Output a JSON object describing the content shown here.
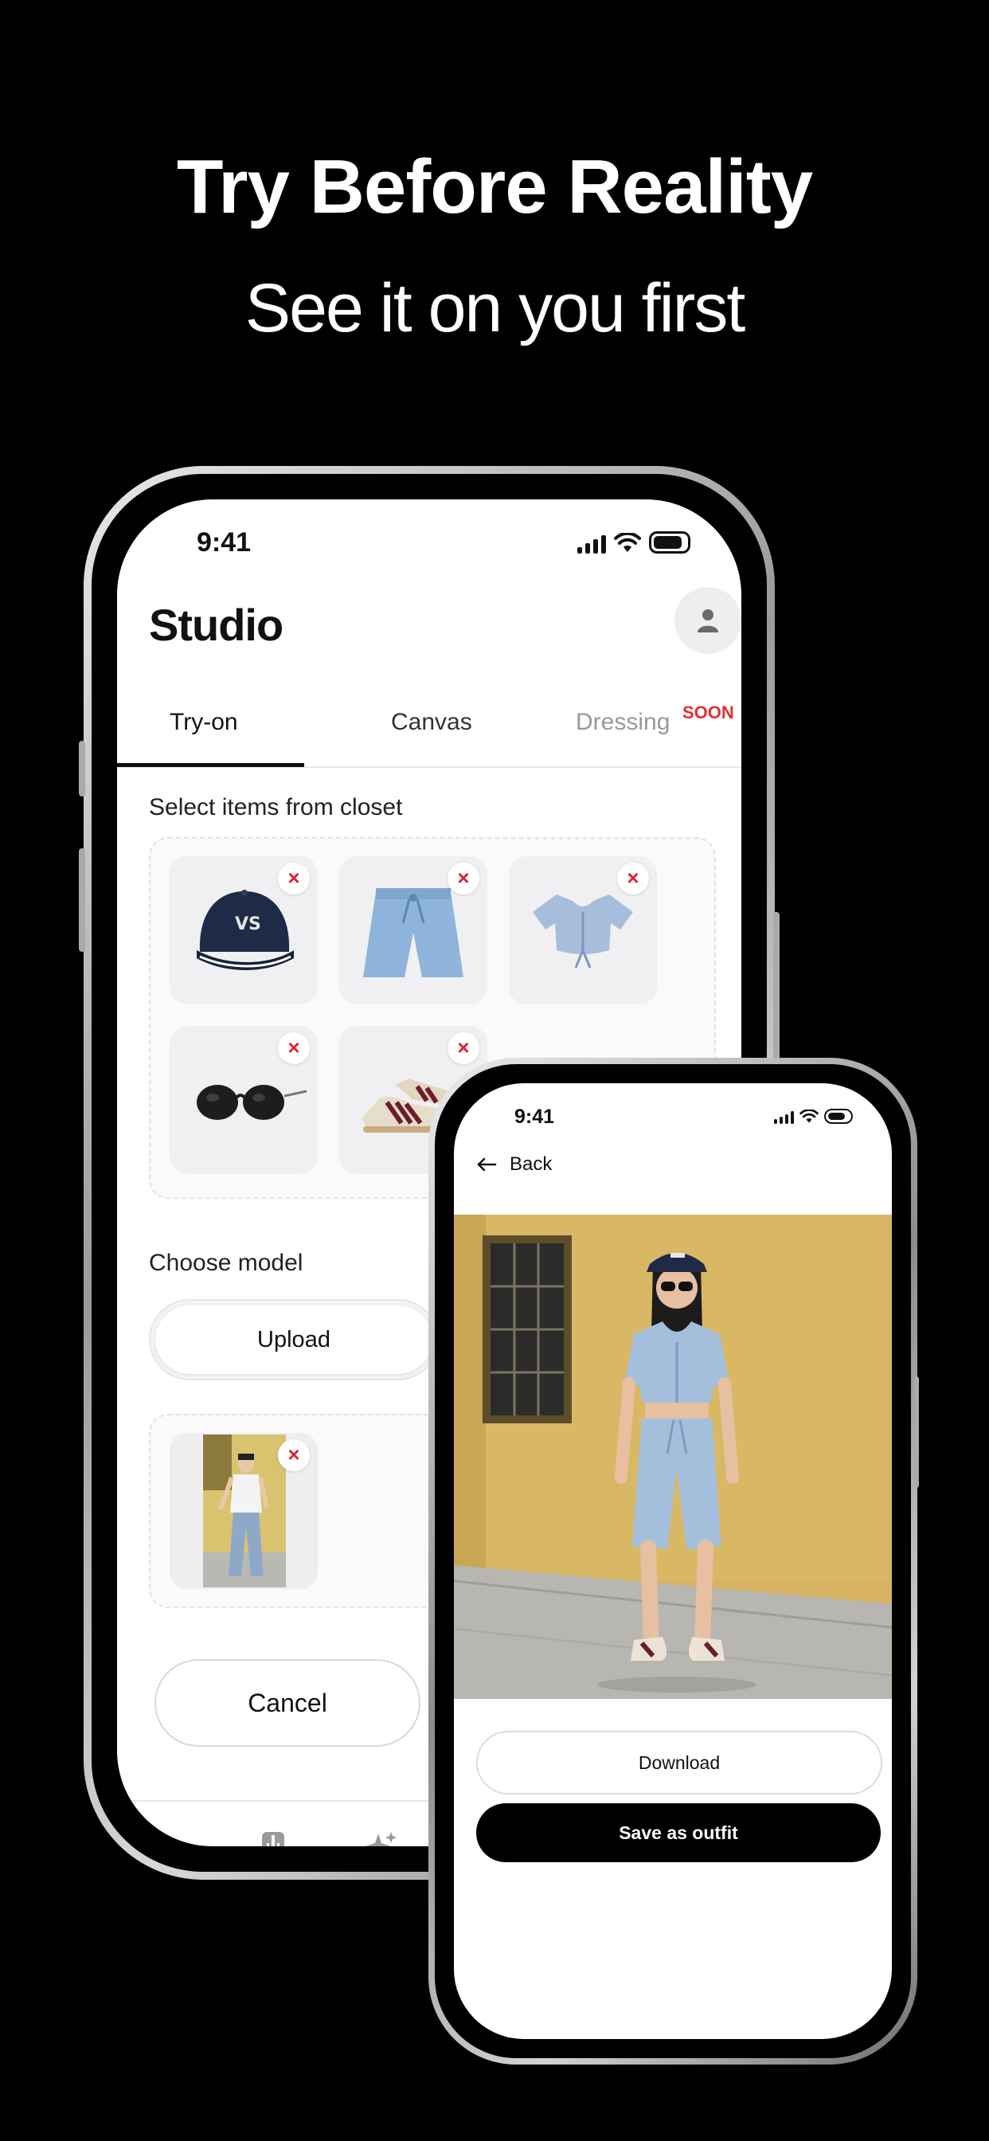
{
  "hero": {
    "title": "Try Before Reality",
    "subtitle": "See it on you first"
  },
  "phone_studio": {
    "status": {
      "time": "9:41"
    },
    "header": {
      "title": "Studio"
    },
    "tabs": [
      {
        "label": "Try-on",
        "active": true
      },
      {
        "label": "Canvas",
        "active": false
      },
      {
        "label": "Dressing",
        "active": false,
        "badge": "SOON"
      }
    ],
    "closet": {
      "label": "Select items from closet",
      "items": [
        {
          "icon": "cap-icon",
          "remove": "×"
        },
        {
          "icon": "shorts-icon",
          "remove": "×"
        },
        {
          "icon": "crop-top-icon",
          "remove": "×"
        },
        {
          "icon": "sunglasses-icon",
          "remove": "×"
        },
        {
          "icon": "sneakers-icon",
          "remove": "×"
        }
      ]
    },
    "model": {
      "label": "Choose model",
      "upload_label": "Upload",
      "remove": "×"
    },
    "cancel_label": "Cancel",
    "nav": [
      "home-icon",
      "wardrobe-icon",
      "sparkle-icon"
    ]
  },
  "phone_result": {
    "status": {
      "time": "9:41"
    },
    "back_label": "Back",
    "download_label": "Download",
    "save_label": "Save as outfit"
  },
  "colors": {
    "accent": "#000000",
    "remove": "#dd2233",
    "soon": "#e03030",
    "wall": "#d6b262"
  }
}
